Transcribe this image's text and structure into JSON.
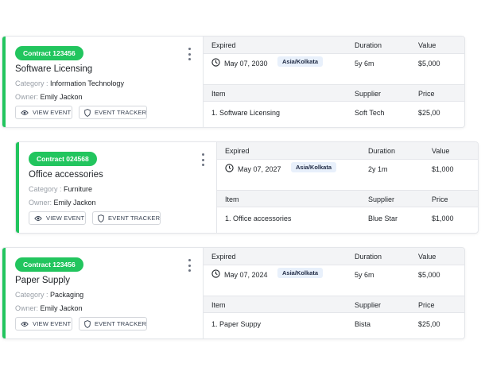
{
  "labels": {
    "category": "Category :",
    "owner": "Owner:",
    "view_event": "VIEW EVENT",
    "event_tracker": "EVENT TRACKER",
    "expired": "Expired",
    "duration": "Duration",
    "value": "Value",
    "item": "Item",
    "supplier": "Supplier",
    "price": "Price"
  },
  "contracts": [
    {
      "badge": "Contract 123456",
      "title": "Software Licensing",
      "category": "Information Technology",
      "owner": "Emily Jackon",
      "expired_date": "May 07, 2030",
      "timezone": "Asia/Kolkata",
      "duration": "5y 6m",
      "value": "$5,000",
      "item": "1. Software Licensing",
      "supplier": "Soft Tech",
      "price": "$25,00"
    },
    {
      "badge": "Contract 024568",
      "title": "Office accessories",
      "category": "Furniture",
      "owner": "Emily Jackon",
      "expired_date": "May 07, 2027",
      "timezone": "Asia/Kolkata",
      "duration": "2y 1m",
      "value": "$1,000",
      "item": "1. Office accessories",
      "supplier": "Blue Star",
      "price": "$1,000"
    },
    {
      "badge": "Contract 123456",
      "title": "Paper Supply",
      "category": "Packaging",
      "owner": "Emily Jackon",
      "expired_date": "May 07, 2024",
      "timezone": "Asia/Kolkata",
      "duration": "5y 6m",
      "value": "$5,000",
      "item": "1. Paper Suppy",
      "supplier": "Bista",
      "price": "$25,00"
    }
  ],
  "colors": {
    "accent": "#22c55e",
    "timezone_bg": "#e8f0fb",
    "header_bg": "#f3f4f6"
  }
}
